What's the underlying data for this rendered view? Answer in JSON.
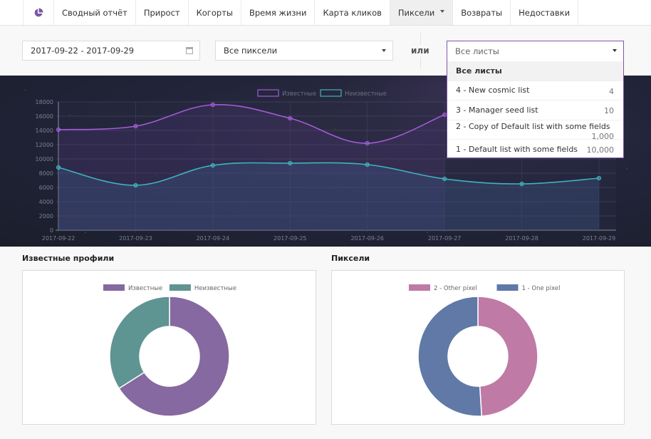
{
  "nav": {
    "logo_icon": "pie-chart-icon",
    "items": [
      {
        "label": "Сводный отчёт",
        "active": false
      },
      {
        "label": "Прирост",
        "active": false
      },
      {
        "label": "Когорты",
        "active": false
      },
      {
        "label": "Время жизни",
        "active": false
      },
      {
        "label": "Карта кликов",
        "active": false
      },
      {
        "label": "Пиксели",
        "active": true,
        "has_dropdown": true
      },
      {
        "label": "Возвраты",
        "active": false
      },
      {
        "label": "Недоставки",
        "active": false
      }
    ]
  },
  "filters": {
    "date_range": "2017-09-22 - 2017-09-29",
    "date_icon": "calendar-icon",
    "pixel_select": "Все пиксели",
    "or_label": "или",
    "list_select": {
      "value": "Все листы",
      "options": [
        {
          "label": "Все листы",
          "count": "",
          "selected": true
        },
        {
          "label": "4 - New cosmic list",
          "count": "4"
        },
        {
          "label": "3 - Manager seed list",
          "count": "10"
        },
        {
          "label": "2 - Copy of Default list with some fields",
          "count": "1,000"
        },
        {
          "label": "1 - Default list with some fields",
          "count": "10,000"
        }
      ]
    }
  },
  "colors": {
    "accent": "#7e57a7",
    "known_line": "#a35ad6",
    "unknown_line": "#3fb3bd",
    "known_pie": "#8669a0",
    "unknown_pie": "#5e9492",
    "other_pixel": "#bf7aa6",
    "one_pixel": "#6079a6"
  },
  "chart_data": [
    {
      "type": "line",
      "title": "",
      "x": [
        "2017-09-22",
        "2017-09-23",
        "2017-09-24",
        "2017-09-25",
        "2017-09-26",
        "2017-09-27",
        "2017-09-28",
        "2017-09-29"
      ],
      "series": [
        {
          "name": "Известные",
          "values": [
            14100,
            14600,
            17600,
            15700,
            12200,
            16200,
            null,
            null
          ]
        },
        {
          "name": "Неизвестные",
          "values": [
            8800,
            6300,
            9100,
            9400,
            9200,
            7200,
            6500,
            7300
          ]
        }
      ],
      "yticks": [
        0,
        2000,
        4000,
        6000,
        8000,
        10000,
        12000,
        14000,
        16000,
        18000
      ],
      "ylim": [
        0,
        18000
      ],
      "grid": true,
      "legend": "top-center",
      "xlabel": "",
      "ylabel": ""
    },
    {
      "type": "pie",
      "title": "Известные профили",
      "categories": [
        "Известные",
        "Неизвестные"
      ],
      "values": [
        66,
        34
      ],
      "donut": true,
      "legend": "top-center"
    },
    {
      "type": "pie",
      "title": "Пиксели",
      "categories": [
        "2 - Other pixel",
        "1 - One pixel"
      ],
      "values": [
        49,
        51
      ],
      "donut": true,
      "legend": "top-center"
    }
  ]
}
